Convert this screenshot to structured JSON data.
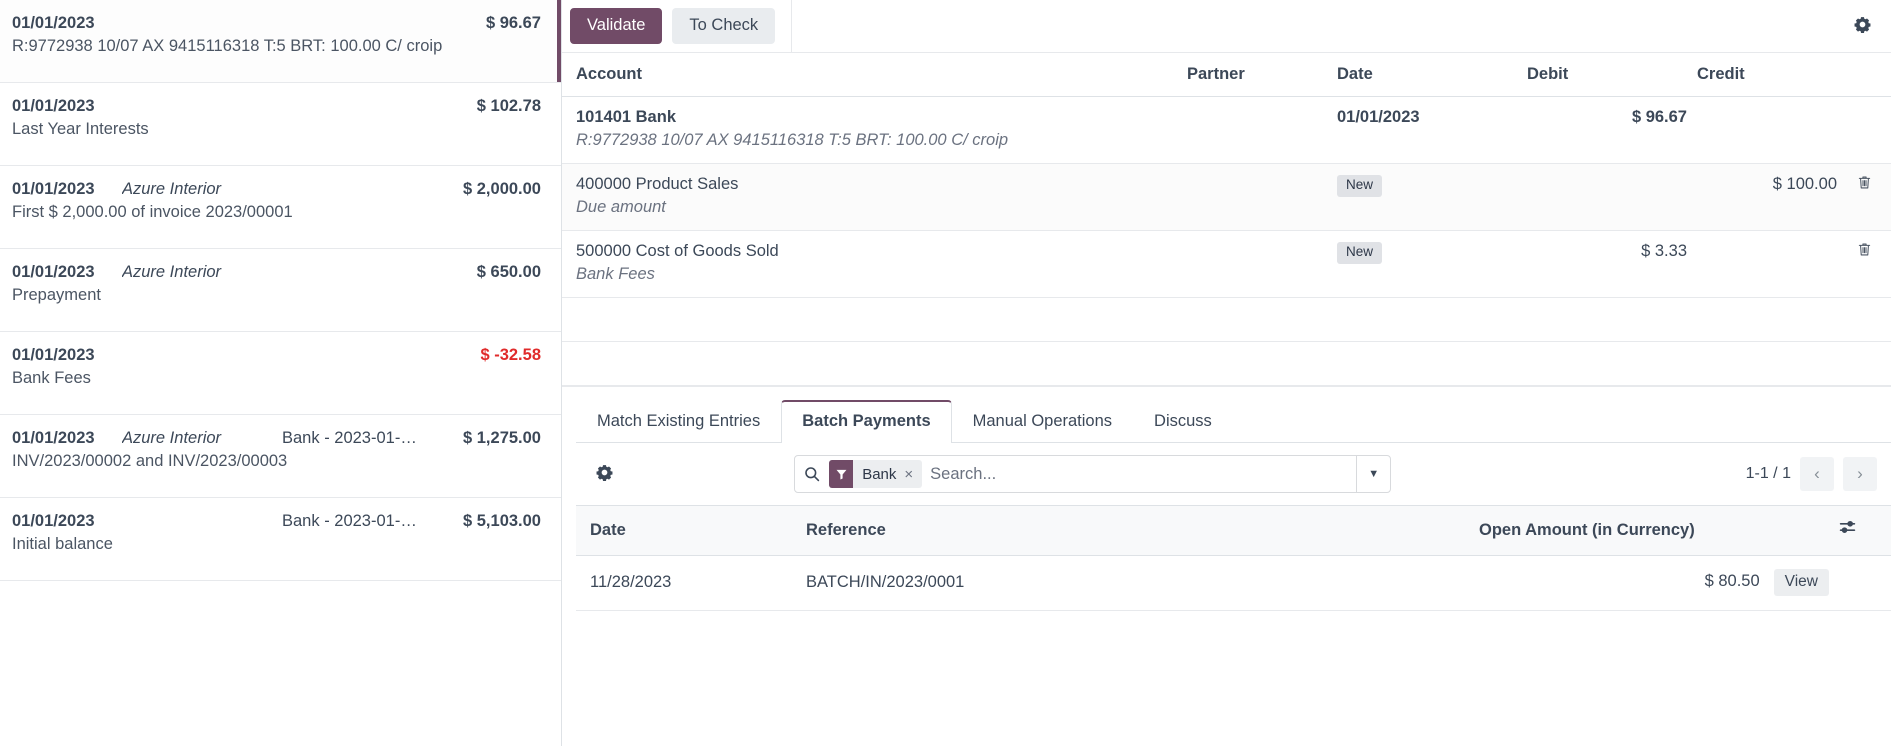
{
  "statement_lines": [
    {
      "date": "01/01/2023",
      "partner": "",
      "reference": "",
      "amount": "$ 96.67",
      "negative": false,
      "label": "R:9772938 10/07 AX 9415116318 T:5 BRT: 100.00 C/ croip",
      "selected": true
    },
    {
      "date": "01/01/2023",
      "partner": "",
      "reference": "",
      "amount": "$ 102.78",
      "negative": false,
      "label": "Last Year Interests",
      "selected": false
    },
    {
      "date": "01/01/2023",
      "partner": "Azure Interior",
      "reference": "",
      "amount": "$ 2,000.00",
      "negative": false,
      "label": "First $ 2,000.00 of invoice 2023/00001",
      "selected": false
    },
    {
      "date": "01/01/2023",
      "partner": "Azure Interior",
      "reference": "",
      "amount": "$ 650.00",
      "negative": false,
      "label": "Prepayment",
      "selected": false
    },
    {
      "date": "01/01/2023",
      "partner": "",
      "reference": "",
      "amount": "$ -32.58",
      "negative": true,
      "label": "Bank Fees",
      "selected": false
    },
    {
      "date": "01/01/2023",
      "partner": "Azure Interior",
      "reference": "Bank - 2023-01-0…",
      "amount": "$ 1,275.00",
      "negative": false,
      "label": "INV/2023/00002 and INV/2023/00003",
      "selected": false
    },
    {
      "date": "01/01/2023",
      "partner": "",
      "reference": "Bank - 2023-01-0…",
      "amount": "$ 5,103.00",
      "negative": false,
      "label": "Initial balance",
      "selected": false
    }
  ],
  "toolbar": {
    "validate_label": "Validate",
    "to_check_label": "To Check",
    "gear_icon": "gear-icon"
  },
  "journal": {
    "columns": {
      "account": "Account",
      "partner": "Partner",
      "date": "Date",
      "debit": "Debit",
      "credit": "Credit"
    },
    "rows": [
      {
        "account": "101401 Bank",
        "account_bold": true,
        "sub": "R:9772938 10/07 AX 9415116318 T:5 BRT: 100.00 C/ croip",
        "partner": "",
        "date": "01/01/2023",
        "badge": "",
        "debit": "$ 96.67",
        "debit_bold": true,
        "credit": "",
        "credit_bold": false,
        "deletable": false
      },
      {
        "account": "400000 Product Sales",
        "account_bold": false,
        "sub": "Due amount",
        "partner": "",
        "date": "",
        "badge": "New",
        "debit": "",
        "debit_bold": false,
        "credit": "$ 100.00",
        "credit_bold": false,
        "deletable": true
      },
      {
        "account": "500000 Cost of Goods Sold",
        "account_bold": false,
        "sub": "Bank Fees",
        "partner": "",
        "date": "",
        "badge": "New",
        "debit": "$ 3.33",
        "debit_bold": false,
        "credit": "",
        "credit_bold": false,
        "deletable": true
      }
    ]
  },
  "tabs": [
    {
      "label": "Match Existing Entries",
      "active": false
    },
    {
      "label": "Batch Payments",
      "active": true
    },
    {
      "label": "Manual Operations",
      "active": false
    },
    {
      "label": "Discuss",
      "active": false
    }
  ],
  "search": {
    "gear_icon": "gear-icon",
    "search_icon": "search-icon",
    "facet_icon": "filter-icon",
    "facet_label": "Bank",
    "facet_remove": "×",
    "placeholder": "Search...",
    "value": "",
    "dropdown_icon": "chevron-down-icon",
    "pager_count": "1-1 / 1",
    "prev_icon": "chevron-left-icon",
    "next_icon": "chevron-right-icon"
  },
  "batch_list": {
    "columns": {
      "date": "Date",
      "reference": "Reference",
      "open_amount": "Open Amount (in Currency)",
      "options_icon": "sliders-icon"
    },
    "rows": [
      {
        "date": "11/28/2023",
        "reference": "BATCH/IN/2023/0001",
        "open_amount": "$ 80.50",
        "view_label": "View"
      }
    ]
  },
  "colors": {
    "accent": "#714B67",
    "negative": "#e02b2b",
    "text": "#3c4858",
    "border": "#dee2e6"
  }
}
